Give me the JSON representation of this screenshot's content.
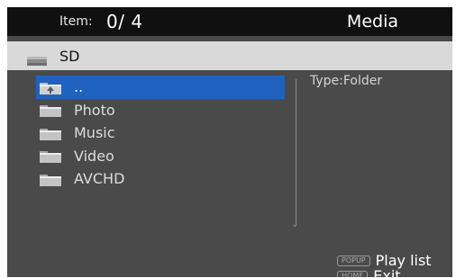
{
  "header": {
    "item_label": "Item:",
    "item_count": "0/ 4",
    "mode_title": "Media"
  },
  "path": {
    "icon": "drive-icon",
    "name": "SD"
  },
  "file_list": [
    {
      "label": "..",
      "icon": "parent-folder-icon",
      "selected": true
    },
    {
      "label": "Photo",
      "icon": "folder-icon",
      "selected": false
    },
    {
      "label": "Music",
      "icon": "folder-icon",
      "selected": false
    },
    {
      "label": "Video",
      "icon": "folder-icon",
      "selected": false
    },
    {
      "label": "AVCHD",
      "icon": "folder-icon",
      "selected": false
    }
  ],
  "info": {
    "type_text": "Type:Folder"
  },
  "hints": [
    {
      "key": "POPUP",
      "label": "Play list"
    },
    {
      "key": "HOME",
      "label": "Exit"
    }
  ],
  "colors": {
    "selection": "#1f62c0",
    "background": "#4a4a4a",
    "topbar": "#101010",
    "pathbar": "#d9d9d9"
  }
}
